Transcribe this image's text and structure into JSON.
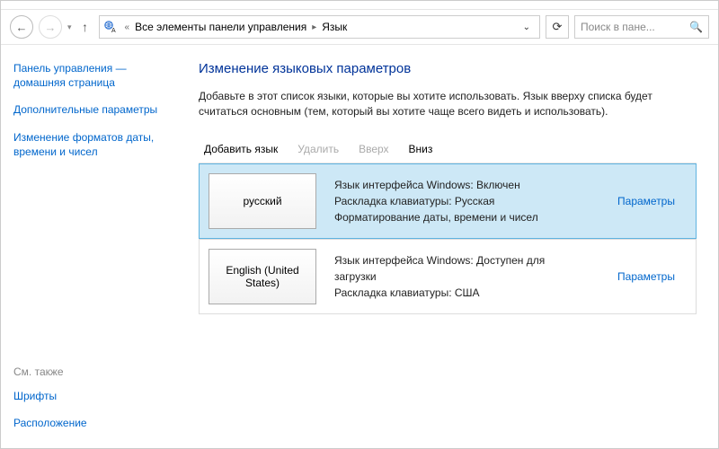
{
  "addressbar": {
    "crumb_all": "Все элементы панели управления",
    "crumb_lang": "Язык",
    "chevron_sep": "«"
  },
  "search": {
    "placeholder": "Поиск в пане..."
  },
  "sidebar": {
    "home": "Панель управления — домашняя страница",
    "advanced": "Дополнительные параметры",
    "formats": "Изменение форматов даты, времени и чисел",
    "seealso_label": "См. также",
    "fonts": "Шрифты",
    "location": "Расположение"
  },
  "main": {
    "heading": "Изменение языковых параметров",
    "intro": "Добавьте в этот список языки, которые вы хотите использовать. Язык вверху списка будет считаться основным (тем, который вы хотите чаще всего видеть и использовать).",
    "toolbar": {
      "add": "Добавить язык",
      "remove": "Удалить",
      "up": "Вверх",
      "down": "Вниз"
    },
    "rows": [
      {
        "name": "русский",
        "line1": "Язык интерфейса Windows: Включен",
        "line2": "Раскладка клавиатуры: Русская",
        "line3": "Форматирование даты, времени и чисел",
        "options": "Параметры"
      },
      {
        "name": "English (United States)",
        "line1": "Язык интерфейса Windows: Доступен для загрузки",
        "line2": "Раскладка клавиатуры: США",
        "line3": "",
        "options": "Параметры"
      }
    ]
  }
}
